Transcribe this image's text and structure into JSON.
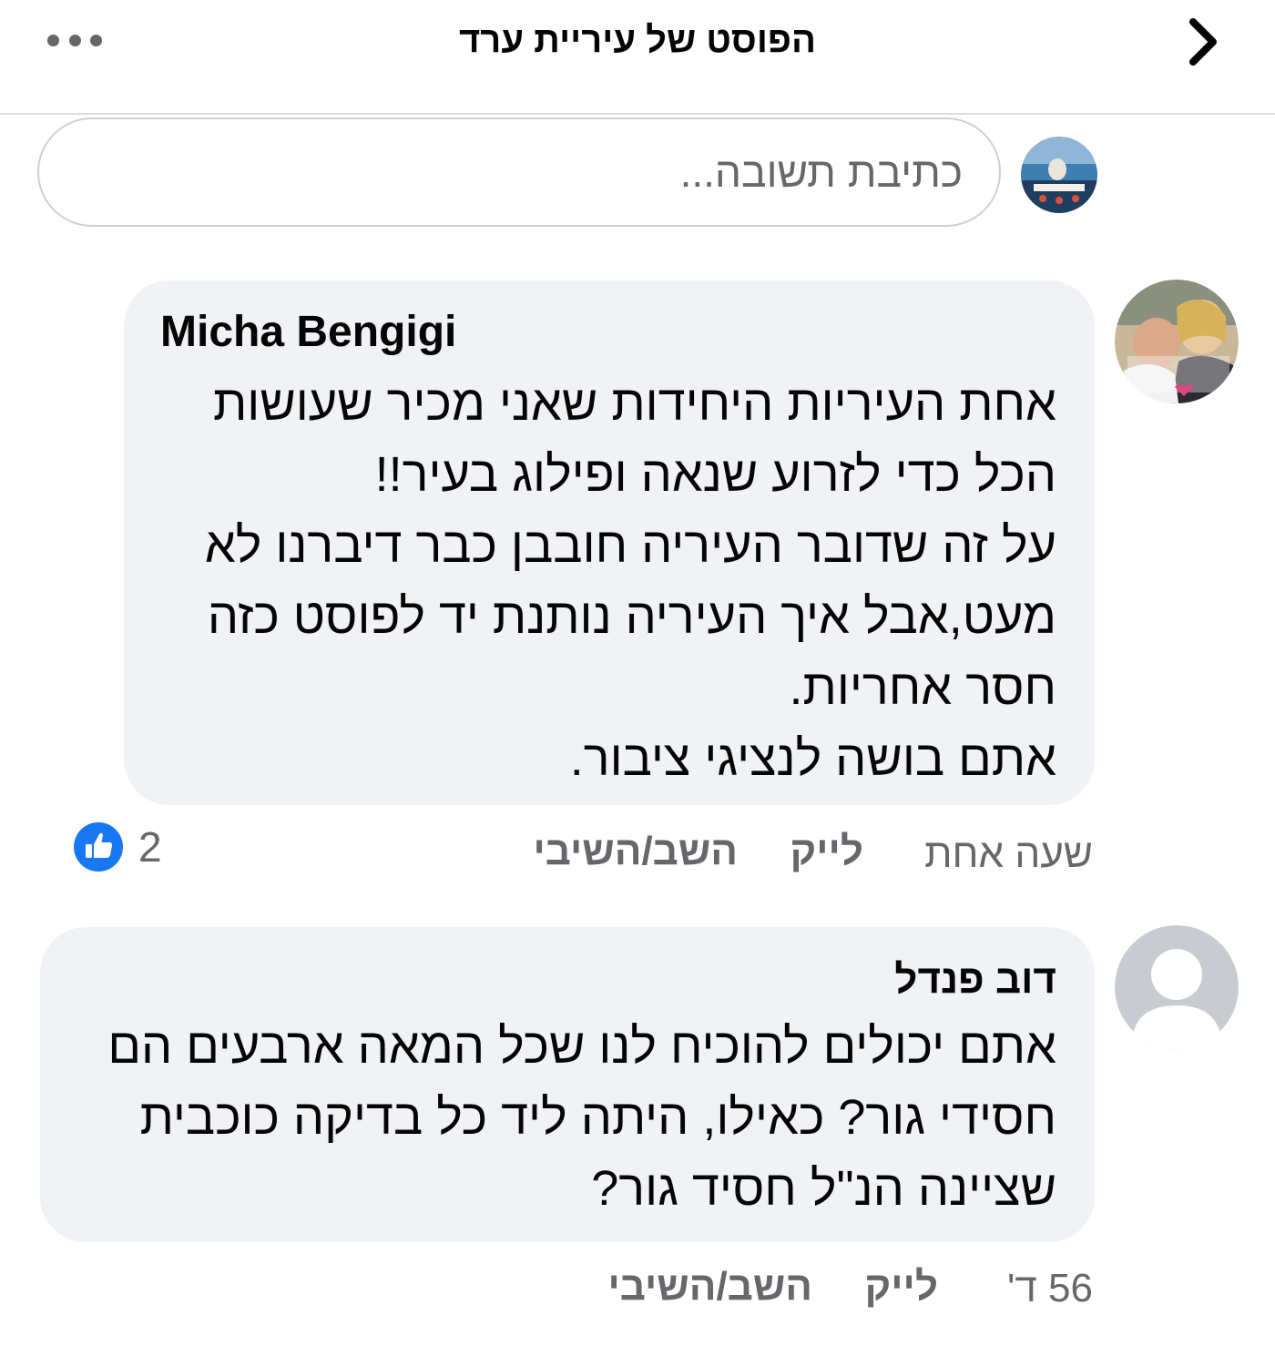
{
  "header": {
    "title": "הפוסט של עיריית ערד",
    "more_icon": "more-horizontal-icon",
    "back_icon": "chevron-right-icon"
  },
  "composer": {
    "placeholder": "כתיבת תשובה..."
  },
  "comments": [
    {
      "author": "Micha Bengigi",
      "lines": [
        "אחת העיריות היחידות שאני מכיר  שעושות",
        "הכל כדי לזרוע שנאה ופילוג בעיר!!",
        "על זה שדובר העיריה חובבן כבר דיברנו לא",
        "מעט,אבל איך העיריה נותנת יד לפוסט כזה",
        "חסר אחריות.",
        "אתם בושה לנציגי ציבור."
      ],
      "time": "שעה אחת",
      "like_label": "לייק",
      "reply_label": "השב/השיבי",
      "reaction_count": "2",
      "reaction_icon": "like-thumb-icon"
    },
    {
      "author": "דוב פנדל",
      "lines": [
        "אתם יכולים להוכיח לנו שכל המאה ארבעים הם",
        "חסידי גור? כאילו, היתה ליד כל בדיקה כוכבית",
        "שציינה הנ\"ל חסיד גור?"
      ],
      "time": "56 ד'",
      "like_label": "לייק",
      "reply_label": "השב/השיבי"
    }
  ],
  "colors": {
    "text_primary": "#050505",
    "text_secondary": "#65676b",
    "bubble_bg": "#f0f2f5",
    "like_blue": "#1877f2",
    "divider": "#dcdde1"
  }
}
